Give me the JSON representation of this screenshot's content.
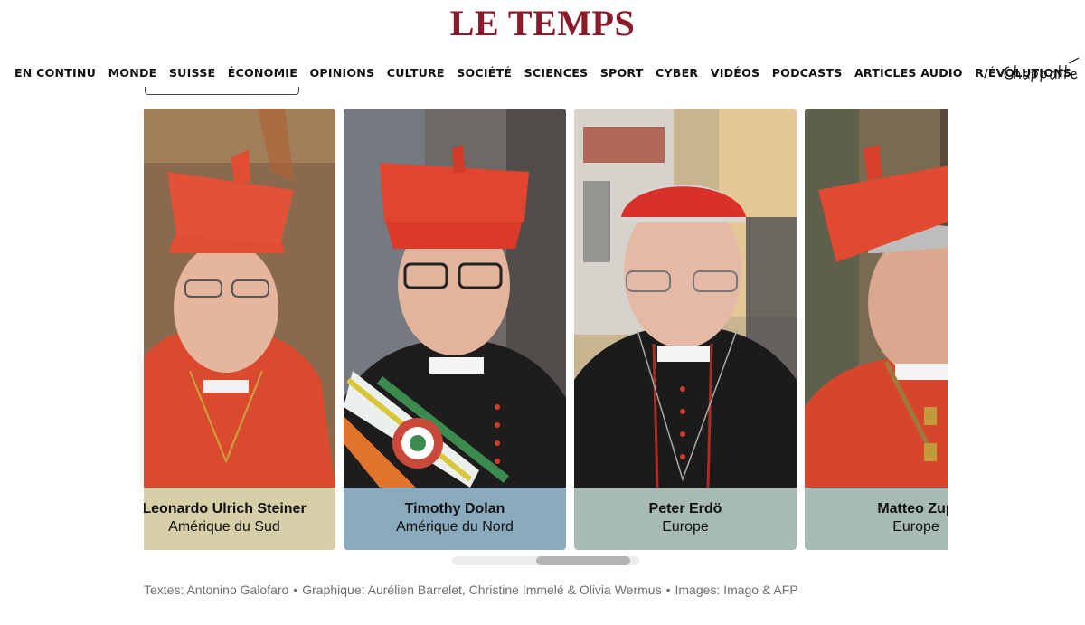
{
  "header": {
    "logo_text": "LE TEMPS",
    "brand_color": "#8b1a2b"
  },
  "nav": {
    "items": [
      "EN CONTINU",
      "MONDE",
      "SUISSE",
      "ÉCONOMIE",
      "OPINIONS",
      "CULTURE",
      "SOCIÉTÉ",
      "SCIENCES",
      "SPORT",
      "CYBER",
      "VIDÉOS",
      "PODCASTS",
      "ARTICLES AUDIO",
      "R/ÉVOLUTIONS"
    ],
    "chappatte_logo": "Chappatte"
  },
  "carousel": {
    "cards": [
      {
        "name": "Leonardo Ulrich Steiner",
        "region": "Amérique du Sud",
        "caption_color": "#d6cfa8",
        "photo_bg": "#8a6a4e"
      },
      {
        "name": "Timothy Dolan",
        "region": "Amérique du Nord",
        "caption_color": "#8aaabd",
        "photo_bg": "#6d6a66"
      },
      {
        "name": "Peter Erdö",
        "region": "Europe",
        "caption_color": "#a7bab6",
        "photo_bg": "#c8b48e"
      },
      {
        "name": "Matteo Zup",
        "region": "Europe",
        "caption_color": "#a7bab6",
        "photo_bg": "#7a6a52"
      }
    ],
    "scroll_position": 0.45
  },
  "credits": {
    "texts": "Textes: Antonino Galofaro",
    "graphics": "Graphique: Aurélien Barrelet, Christine Immelé & Olivia Wermus",
    "images": "Images: Imago & AFP",
    "separator": "•"
  }
}
